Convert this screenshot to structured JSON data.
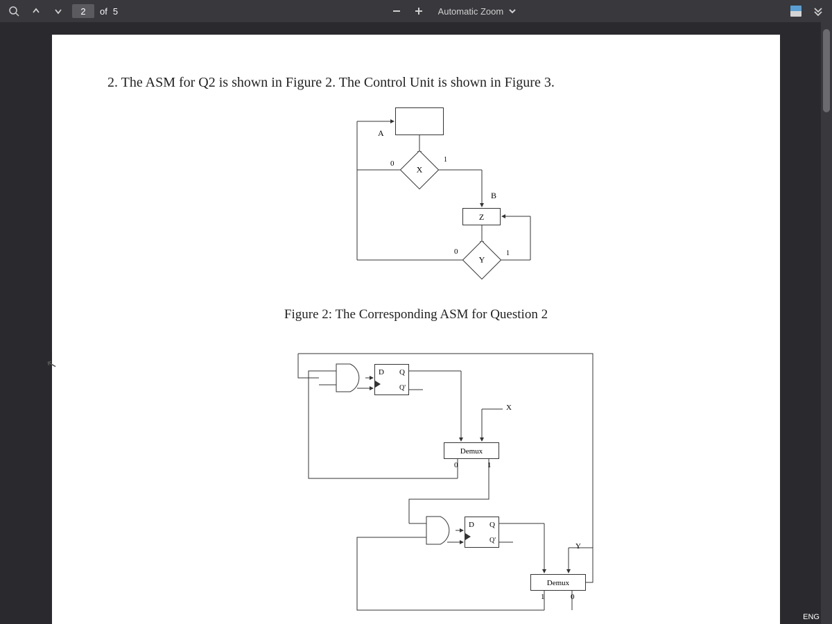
{
  "toolbar": {
    "page_current": "2",
    "page_sep": "of",
    "page_total": "5",
    "zoom_label": "Automatic Zoom"
  },
  "document": {
    "question": "2. The ASM for Q2 is shown in Figure 2. The Control Unit is shown in Figure 3.",
    "figure2_caption": "Figure 2: The Corresponding ASM for Question 2",
    "asm": {
      "state_a": "A",
      "decision_x": "X",
      "branch0": "0",
      "branch1": "1",
      "state_b": "B",
      "output_z": "Z",
      "decision_y": "Y",
      "y_branch0": "0",
      "y_branch1": "1"
    },
    "ctrl": {
      "ff_d": "D",
      "ff_q": "Q",
      "ff_qbar": "Q'",
      "demux": "Demux",
      "input_x": "X",
      "input_y": "Y",
      "out0": "0",
      "out1": "1"
    }
  },
  "system": {
    "lang": "ENG"
  }
}
